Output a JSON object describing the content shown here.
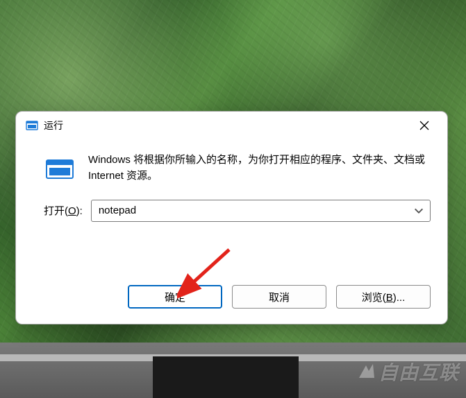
{
  "dialog": {
    "title": "运行",
    "description": "Windows 将根据你所输入的名称，为你打开相应的程序、文件夹、文档或 Internet 资源。",
    "open_label_prefix": "打开(",
    "open_label_mnemonic": "O",
    "open_label_suffix": "):",
    "input_value": "notepad",
    "ok_label": "确定",
    "cancel_label": "取消",
    "browse_label_prefix": "浏览(",
    "browse_label_mnemonic": "B",
    "browse_label_suffix": ")..."
  },
  "watermark": {
    "text": "自由互联"
  }
}
